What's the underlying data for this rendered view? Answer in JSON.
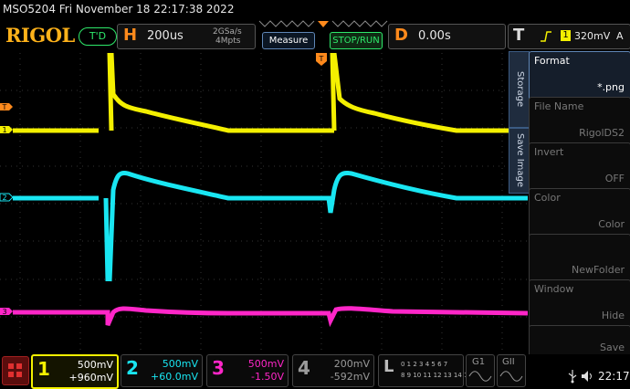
{
  "device": {
    "title": "MSO5204  Fri November 18 22:17:38 2022",
    "brand": "RIGOL",
    "trigger_state": "T'D"
  },
  "horizontal": {
    "label": "H",
    "timebase": "200us",
    "sample_rate": "2GSa/s",
    "memory_depth": "4Mpts"
  },
  "buttons": {
    "measure": "Measure",
    "stop_run": "STOP/RUN"
  },
  "delay": {
    "label": "D",
    "value": "0.00s"
  },
  "trigger": {
    "label": "T",
    "source": "1",
    "level": "320mV",
    "mode": "A"
  },
  "markers": {
    "trigger_marker": "T",
    "ch1": "1",
    "ch2": "2",
    "ch3": "3"
  },
  "side_menu": {
    "tabs": [
      "Storage",
      "Save Image"
    ],
    "items": [
      {
        "label": "Format",
        "value": "*.png"
      },
      {
        "label": "File Name",
        "value": "RigolDS2"
      },
      {
        "label": "Invert",
        "value": "OFF"
      },
      {
        "label": "Color",
        "value": "Color"
      },
      {
        "label": "",
        "value": "NewFolder"
      },
      {
        "label": "Window",
        "value": "Hide"
      },
      {
        "label": "",
        "value": "Save"
      }
    ]
  },
  "channels": [
    {
      "num": "1",
      "scale": "500mV",
      "offset": "+960mV",
      "color": "#f4f000"
    },
    {
      "num": "2",
      "scale": "500mV",
      "offset": "+60.0mV",
      "color": "#19e6f2"
    },
    {
      "num": "3",
      "scale": "500mV",
      "offset": "-1.50V",
      "color": "#ff26c8"
    },
    {
      "num": "4",
      "scale": "200mV",
      "offset": "-592mV",
      "color": "#9a9a9a"
    }
  ],
  "logic": {
    "label": "L",
    "row1": "0 1 2 3 4 5 6 7",
    "row2": "8 9 10 11 12 13 14 15"
  },
  "generators": [
    "G1",
    "GII"
  ],
  "status": {
    "time": "22:17"
  },
  "colors": {
    "accent": "#ff8a1c",
    "ok": "#2ee86a",
    "panel": "#1f2c3e"
  }
}
